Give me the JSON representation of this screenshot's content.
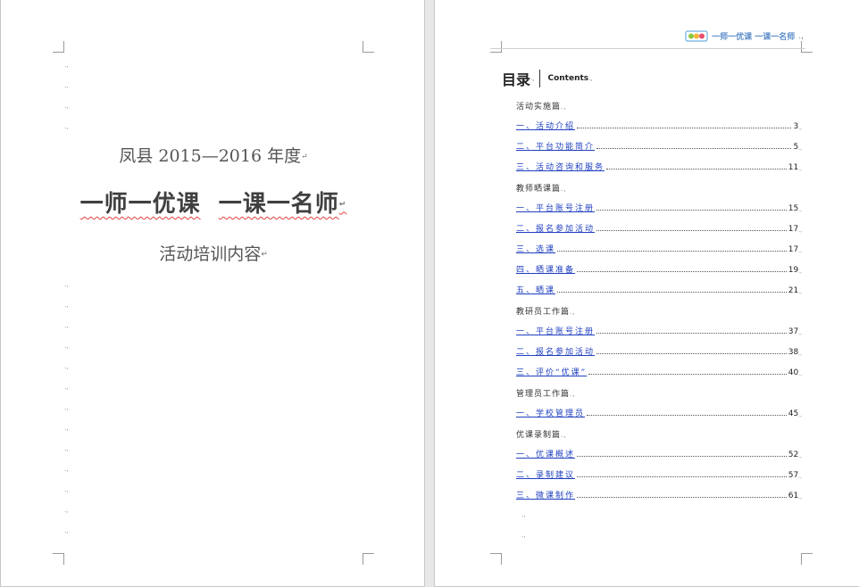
{
  "cover": {
    "year_line": "凤县 2015—2016 年度",
    "title_a": "一师一优课",
    "title_b": "一课一名师",
    "subtitle": "活动培训内容",
    "return_mark": "↵"
  },
  "header": {
    "logo_text": "一师一优课 一课一名师",
    "mark": ".,"
  },
  "toc": {
    "title": "目录",
    "mark": ".,",
    "subtitle": "Contents",
    "sections": [
      {
        "title": "活动实施篇",
        "entries": [
          {
            "label": "一、活动介绍",
            "page": "3"
          },
          {
            "label": "二、平台功能简介",
            "page": "5"
          },
          {
            "label": "三、活动咨询和服务",
            "page": "11"
          }
        ]
      },
      {
        "title": "教师晒课篇",
        "entries": [
          {
            "label": "一、平台账号注册",
            "page": "15"
          },
          {
            "label": "二、报名参加活动",
            "page": "17"
          },
          {
            "label": "三、选课",
            "page": "17"
          },
          {
            "label": "四、晒课准备",
            "page": "19"
          },
          {
            "label": "五、晒课",
            "page": "21"
          }
        ]
      },
      {
        "title": "教研员工作篇",
        "entries": [
          {
            "label": "一、平台账号注册",
            "page": "37"
          },
          {
            "label": "二、报名参加活动",
            "page": "38"
          },
          {
            "label": "三、评价“优课”",
            "page": "40"
          }
        ]
      },
      {
        "title": "管理员工作篇",
        "entries": [
          {
            "label": "一、学校管理员",
            "page": "45"
          }
        ]
      },
      {
        "title": "优课录制篇",
        "entries": [
          {
            "label": "一、优课概述",
            "page": "52"
          },
          {
            "label": "二、录制建议",
            "page": "57"
          },
          {
            "label": "三、微课制作",
            "page": "61"
          }
        ]
      }
    ]
  },
  "marks": {
    "paragraph": ".,"
  }
}
